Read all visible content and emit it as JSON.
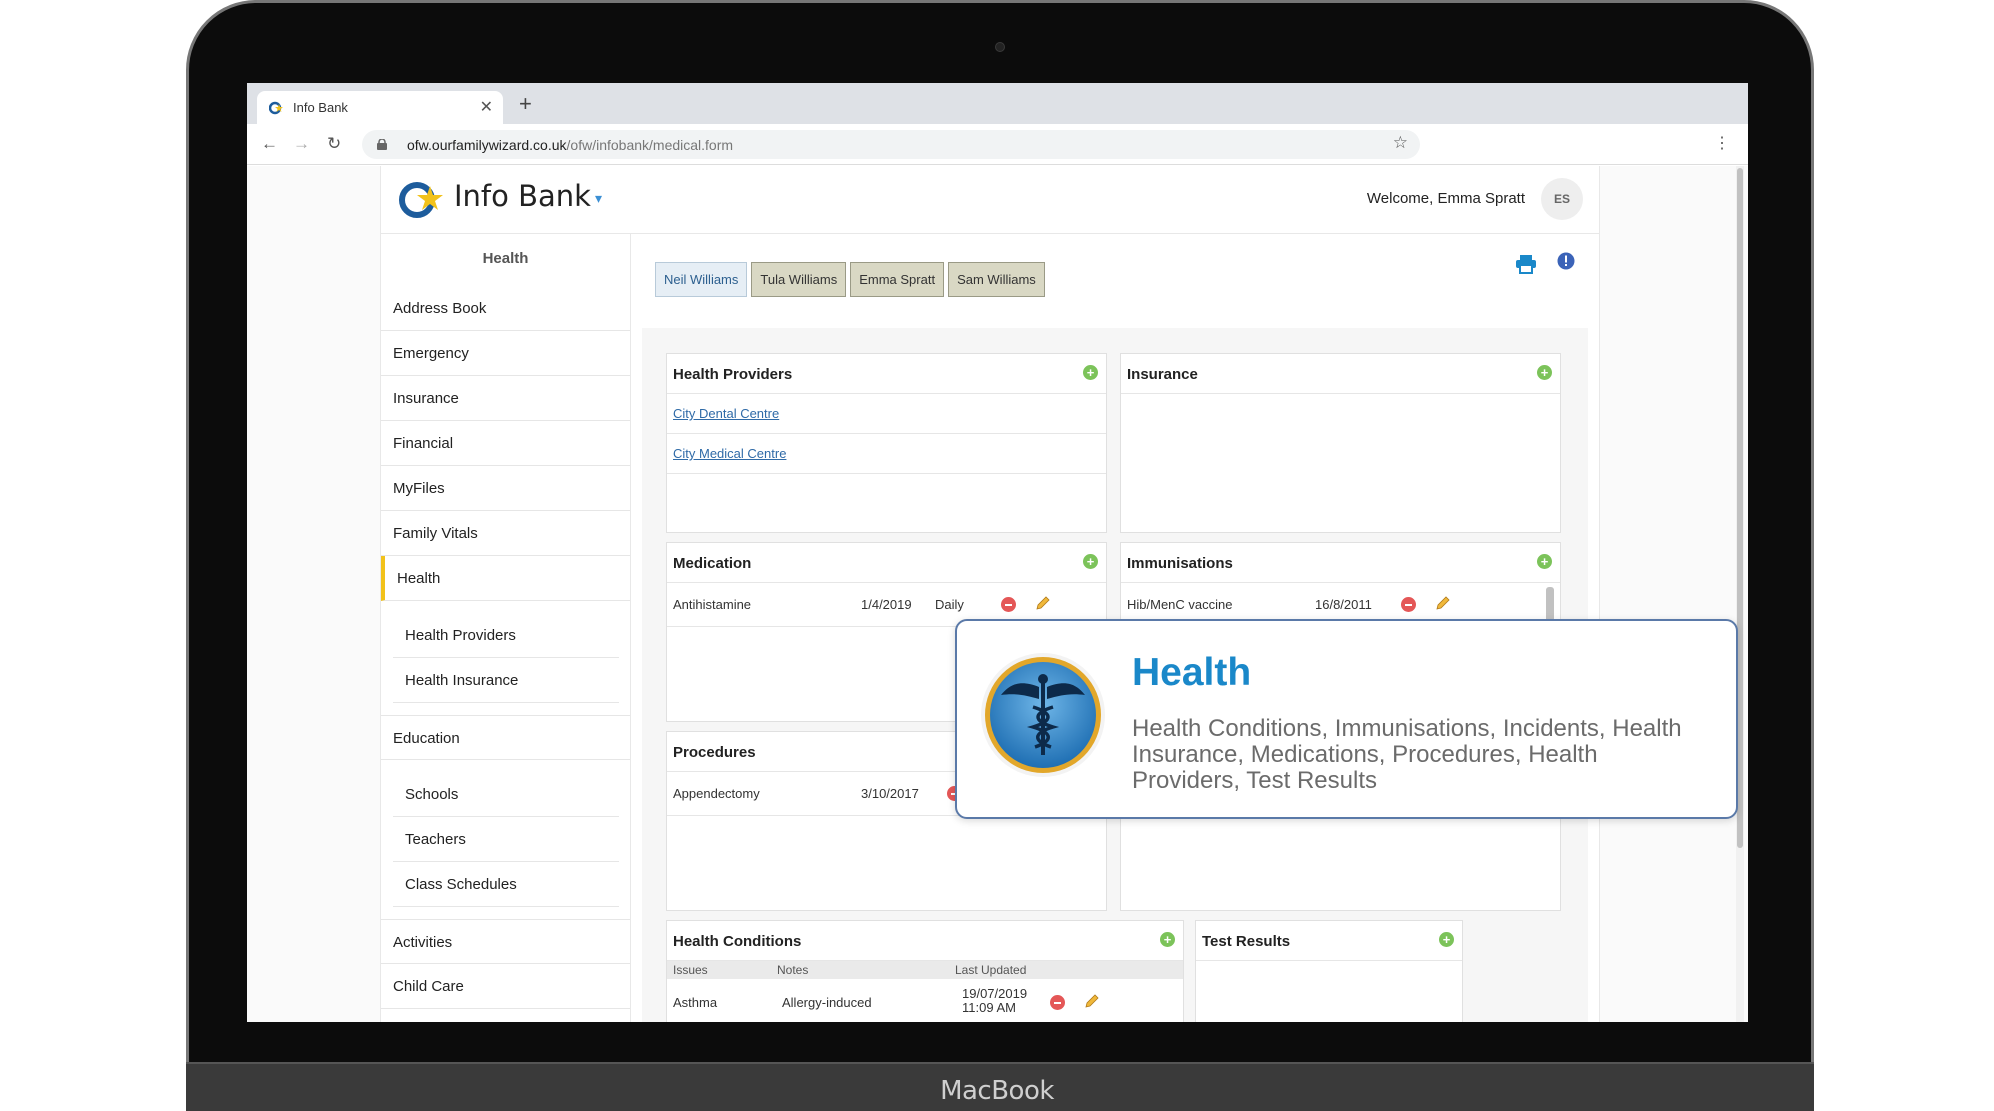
{
  "device": {
    "brand": "MacBook"
  },
  "browser": {
    "tab_title": "Info Bank",
    "url_domain": "ofw.ourfamilywizard.co.uk",
    "url_path": "/ofw/infobank/medical.form"
  },
  "header": {
    "app_title": "Info Bank",
    "welcome": "Welcome, Emma Spratt",
    "avatar_initials": "ES"
  },
  "sidebar": {
    "section_title": "Health",
    "items_top": [
      "Address Book",
      "Emergency",
      "Insurance",
      "Financial",
      "MyFiles",
      "Family Vitals"
    ],
    "active_item": "Health",
    "health_sub": [
      "Health Providers",
      "Health Insurance"
    ],
    "education": "Education",
    "education_sub": [
      "Schools",
      "Teachers",
      "Class Schedules"
    ],
    "items_bottom": [
      "Activities",
      "Child Care"
    ]
  },
  "person_tabs": [
    "Neil Williams",
    "Tula Williams",
    "Emma Spratt",
    "Sam Williams"
  ],
  "cards": {
    "health_providers": {
      "title": "Health Providers",
      "links": [
        "City Dental Centre",
        "City Medical Centre"
      ]
    },
    "insurance": {
      "title": "Insurance"
    },
    "medication": {
      "title": "Medication",
      "row": {
        "name": "Antihistamine",
        "date": "1/4/2019",
        "freq": "Daily"
      }
    },
    "immunisations": {
      "title": "Immunisations",
      "row": {
        "name": "Hib/MenC vaccine",
        "date": "16/8/2011"
      }
    },
    "procedures": {
      "title": "Procedures",
      "row": {
        "name": "Appendectomy",
        "date": "3/10/2017"
      }
    },
    "health_conditions": {
      "title": "Health Conditions",
      "columns": [
        "Issues",
        "Notes",
        "Last Updated"
      ],
      "row": {
        "issue": "Asthma",
        "notes": "Allergy-induced",
        "date": "19/07/2019",
        "time": "11:09 AM"
      }
    },
    "test_results": {
      "title": "Test Results"
    }
  },
  "popup": {
    "title": "Health",
    "description": "Health Conditions, Immunisations, Incidents, Health Insurance, Medications, Procedures, Health Providers, Test Results"
  },
  "colors": {
    "accent": "#1a88c9",
    "active_marker": "#f2c21b",
    "add": "#7cc35a",
    "delete": "#e45757"
  }
}
